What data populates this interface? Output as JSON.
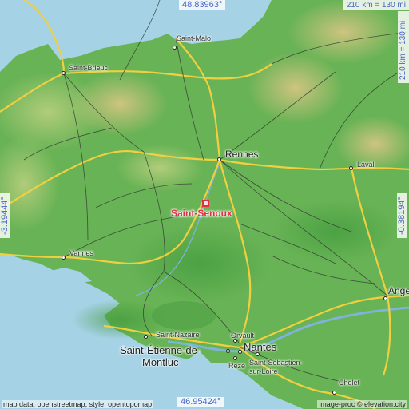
{
  "focus": {
    "name": "Saint-Senoux",
    "color": "#e0303e"
  },
  "coordinates": {
    "top": "48.83963°",
    "bottom": "46.95424°",
    "left": "-3.19444°",
    "right": "-0.38194°"
  },
  "scale": {
    "horizontal": "210 km = 130 mi",
    "vertical": "210 km = 130 mi"
  },
  "cities": {
    "saint_malo": "Saint-Malo",
    "saint_brieuc": "Saint-Brieuc",
    "rennes": "Rennes",
    "laval": "Laval",
    "vannes": "Vannes",
    "angers": "Angers",
    "saint_nazaire": "Saint-Nazaire",
    "orvault": "Orvault",
    "saint_etienne_line1": "Saint-Étienne-de-",
    "saint_etienne_line2": "Montluc",
    "nantes": "Nantes",
    "reze": "Rezé",
    "saint_sebastien_line1": "Saint-Sébastien-",
    "saint_sebastien_line2": "sur-Loire",
    "cholet": "Cholet"
  },
  "attribution": {
    "left": "map data: openstreetmap, style: opentopomap",
    "right": "image-proc © elevation.city"
  },
  "colors": {
    "sea": "#a6d2e6",
    "land_low": "#5cae4c",
    "land_mid": "#8cc06a",
    "land_high": "#d4c07a",
    "motorway": "#f0d040",
    "road": "#333333",
    "coord_text": "#4a63c8"
  }
}
